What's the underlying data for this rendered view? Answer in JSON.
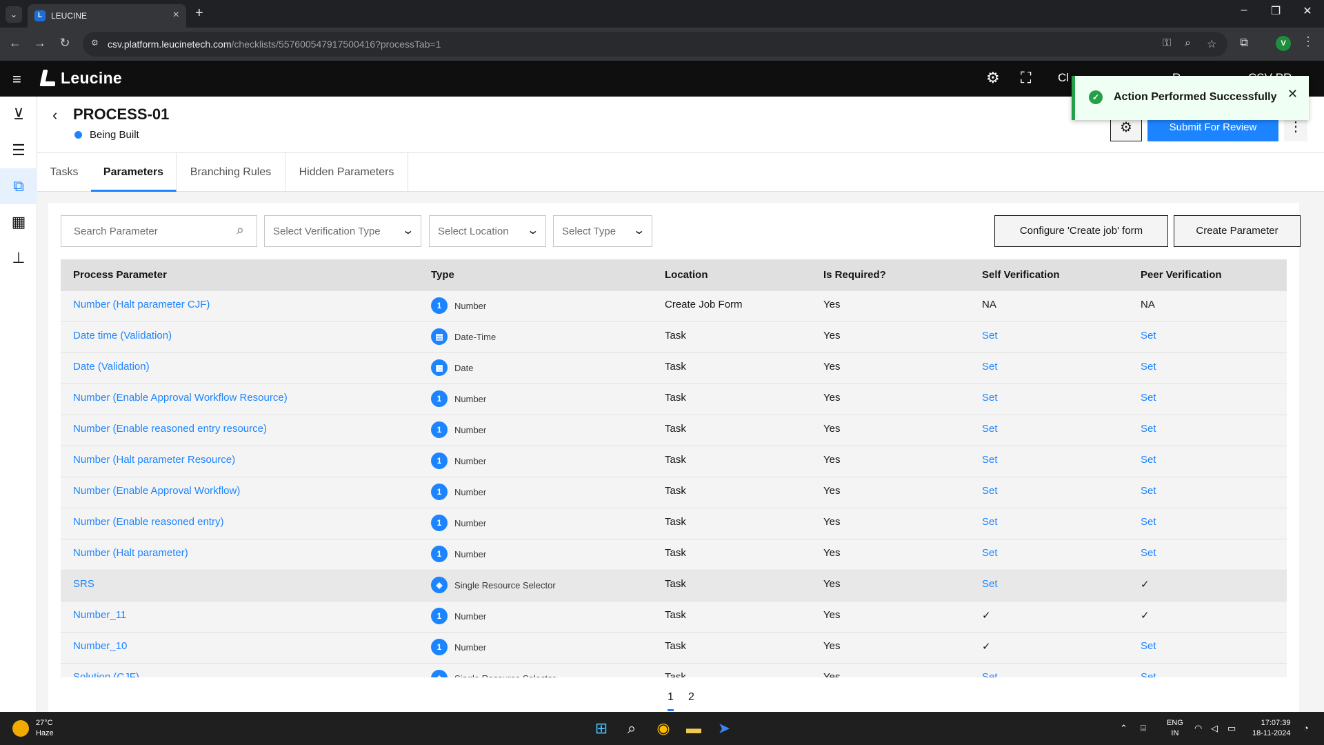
{
  "browser": {
    "tab_title": "LEUCINE",
    "url_host": "csv.platform.leucinetech.com",
    "url_path": "/checklists/557600547917500416?processTab=1",
    "profile_initial": "V"
  },
  "app": {
    "logo_text": "Leucine",
    "header_items": [
      "Cl",
      "R",
      "CSV-PR"
    ]
  },
  "toast": {
    "message": "Action Performed Successfully"
  },
  "process": {
    "title": "PROCESS-01",
    "status": "Being Built",
    "submit_label": "Submit For Review"
  },
  "tabs": [
    {
      "label": "Tasks",
      "active": false
    },
    {
      "label": "Parameters",
      "active": true
    },
    {
      "label": "Branching Rules",
      "active": false
    },
    {
      "label": "Hidden Parameters",
      "active": false
    }
  ],
  "filters": {
    "search_placeholder": "Search Parameter",
    "verification_placeholder": "Select Verification Type",
    "location_placeholder": "Select Location",
    "type_placeholder": "Select Type",
    "configure_label": "Configure 'Create job' form",
    "create_label": "Create Parameter"
  },
  "table": {
    "columns": [
      "Process Parameter",
      "Type",
      "Location",
      "Is Required?",
      "Self Verification",
      "Peer Verification"
    ],
    "rows": [
      {
        "name": "Number (Halt parameter CJF)",
        "type": "Number",
        "type_icon": "number-icon",
        "location": "Create Job Form",
        "required": "Yes",
        "self": "NA",
        "peer": "NA"
      },
      {
        "name": "Date time (Validation)",
        "type": "Date-Time",
        "type_icon": "datetime-icon",
        "location": "Task",
        "required": "Yes",
        "self": "Set",
        "peer": "Set"
      },
      {
        "name": "Date (Validation)",
        "type": "Date",
        "type_icon": "date-icon",
        "location": "Task",
        "required": "Yes",
        "self": "Set",
        "peer": "Set"
      },
      {
        "name": "Number (Enable Approval Workflow Resource)",
        "type": "Number",
        "type_icon": "number-icon",
        "location": "Task",
        "required": "Yes",
        "self": "Set",
        "peer": "Set"
      },
      {
        "name": "Number (Enable reasoned entry resource)",
        "type": "Number",
        "type_icon": "number-icon",
        "location": "Task",
        "required": "Yes",
        "self": "Set",
        "peer": "Set"
      },
      {
        "name": "Number (Halt parameter Resource)",
        "type": "Number",
        "type_icon": "number-icon",
        "location": "Task",
        "required": "Yes",
        "self": "Set",
        "peer": "Set"
      },
      {
        "name": "Number (Enable Approval Workflow)",
        "type": "Number",
        "type_icon": "number-icon",
        "location": "Task",
        "required": "Yes",
        "self": "Set",
        "peer": "Set"
      },
      {
        "name": "Number (Enable reasoned entry)",
        "type": "Number",
        "type_icon": "number-icon",
        "location": "Task",
        "required": "Yes",
        "self": "Set",
        "peer": "Set"
      },
      {
        "name": "Number (Halt parameter)",
        "type": "Number",
        "type_icon": "number-icon",
        "location": "Task",
        "required": "Yes",
        "self": "Set",
        "peer": "Set"
      },
      {
        "name": "SRS",
        "type": "Single Resource Selector",
        "type_icon": "resource-icon",
        "location": "Task",
        "required": "Yes",
        "self": "Set",
        "peer": "✓"
      },
      {
        "name": "Number_11",
        "type": "Number",
        "type_icon": "number-icon",
        "location": "Task",
        "required": "Yes",
        "self": "✓",
        "peer": "✓"
      },
      {
        "name": "Number_10",
        "type": "Number",
        "type_icon": "number-icon",
        "location": "Task",
        "required": "Yes",
        "self": "✓",
        "peer": "Set"
      },
      {
        "name": "Solution (CJF)",
        "type": "Single Resource Selector",
        "type_icon": "resource-icon",
        "location": "Task",
        "required": "Yes",
        "self": "Set",
        "peer": "Set"
      }
    ]
  },
  "pagination": {
    "pages": [
      "1",
      "2"
    ],
    "current": "1"
  },
  "taskbar": {
    "temperature": "27°C",
    "weather": "Haze",
    "lang": "ENG",
    "region": "IN",
    "time": "17:07:39",
    "date": "18-11-2024"
  },
  "colors": {
    "accent": "#1d84ff",
    "success": "#24a148",
    "header_bg": "#0f0f0f"
  }
}
